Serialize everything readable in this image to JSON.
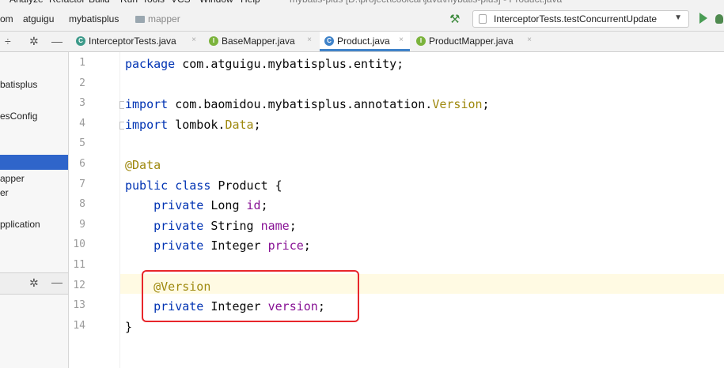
{
  "menubar": {
    "items": [
      "Analyze",
      "Refactor",
      "Build",
      "Run",
      "Tools",
      "VCS",
      "Window",
      "Help"
    ],
    "title": "mybatis-plus [D:\\project\\coolcar\\java\\mybatis-plus] - Product.java"
  },
  "breadcrumb": {
    "items": [
      "om",
      "atguigu",
      "mybatisplus",
      "mapper"
    ]
  },
  "toolbar": {
    "run_config": "InterceptorTests.testConcurrentUpdate",
    "dropdown_glyph": "▼"
  },
  "project_toolbar": {
    "layout_glyph": "÷",
    "settings_glyph": "✲",
    "minimize_glyph": "—"
  },
  "tabs": [
    {
      "label": "InterceptorTests.java",
      "icon": "test-class-icon",
      "icon_glyph": "C",
      "icon_color": "#3d9a8a",
      "active": false
    },
    {
      "label": "BaseMapper.java",
      "icon": "interface-icon",
      "icon_glyph": "I",
      "icon_color": "#7bb33c",
      "active": false
    },
    {
      "label": "Product.java",
      "icon": "class-icon",
      "icon_glyph": "C",
      "icon_color": "#4083c9",
      "active": true
    },
    {
      "label": "ProductMapper.java",
      "icon": "interface-icon",
      "icon_glyph": "I",
      "icon_color": "#7bb33c",
      "active": false
    }
  ],
  "tab_close_glyph": "×",
  "project_tree": {
    "items": [
      "batisplus",
      "esConfig",
      "apper",
      "er",
      "pplication"
    ]
  },
  "bottom_panel": {
    "settings_glyph": "✲",
    "minimize_glyph": "—"
  },
  "editor": {
    "line_numbers": [
      "1",
      "2",
      "3",
      "4",
      "5",
      "6",
      "7",
      "8",
      "9",
      "10",
      "11",
      "12",
      "13",
      "14"
    ],
    "lines": [
      [
        {
          "t": "package",
          "c": "kw"
        },
        {
          "t": " com.atguigu.mybatisplus.entity;",
          "c": ""
        }
      ],
      [],
      [
        {
          "t": "import",
          "c": "kw"
        },
        {
          "t": " com.baomidou.mybatisplus.annotation.",
          "c": ""
        },
        {
          "t": "Version",
          "c": "ann"
        },
        {
          "t": ";",
          "c": ""
        }
      ],
      [
        {
          "t": "import",
          "c": "kw"
        },
        {
          "t": " lombok.",
          "c": ""
        },
        {
          "t": "Data",
          "c": "ann"
        },
        {
          "t": ";",
          "c": ""
        }
      ],
      [],
      [
        {
          "t": "@Data",
          "c": "ann"
        }
      ],
      [
        {
          "t": "public class",
          "c": "kw"
        },
        {
          "t": " Product {",
          "c": ""
        }
      ],
      [
        {
          "t": "    ",
          "c": ""
        },
        {
          "t": "private",
          "c": "kw"
        },
        {
          "t": " Long ",
          "c": ""
        },
        {
          "t": "id",
          "c": "fld"
        },
        {
          "t": ";",
          "c": ""
        }
      ],
      [
        {
          "t": "    ",
          "c": ""
        },
        {
          "t": "private",
          "c": "kw"
        },
        {
          "t": " String ",
          "c": ""
        },
        {
          "t": "name",
          "c": "fld"
        },
        {
          "t": ";",
          "c": ""
        }
      ],
      [
        {
          "t": "    ",
          "c": ""
        },
        {
          "t": "private",
          "c": "kw"
        },
        {
          "t": " Integer ",
          "c": ""
        },
        {
          "t": "price",
          "c": "fld"
        },
        {
          "t": ";",
          "c": ""
        }
      ],
      [],
      [
        {
          "t": "    ",
          "c": ""
        },
        {
          "t": "@Version",
          "c": "ann"
        }
      ],
      [
        {
          "t": "    ",
          "c": ""
        },
        {
          "t": "private",
          "c": "kw"
        },
        {
          "t": " Integer ",
          "c": ""
        },
        {
          "t": "version",
          "c": "fld"
        },
        {
          "t": ";",
          "c": ""
        }
      ],
      [
        {
          "t": "}",
          "c": ""
        }
      ]
    ],
    "current_line": 12
  }
}
